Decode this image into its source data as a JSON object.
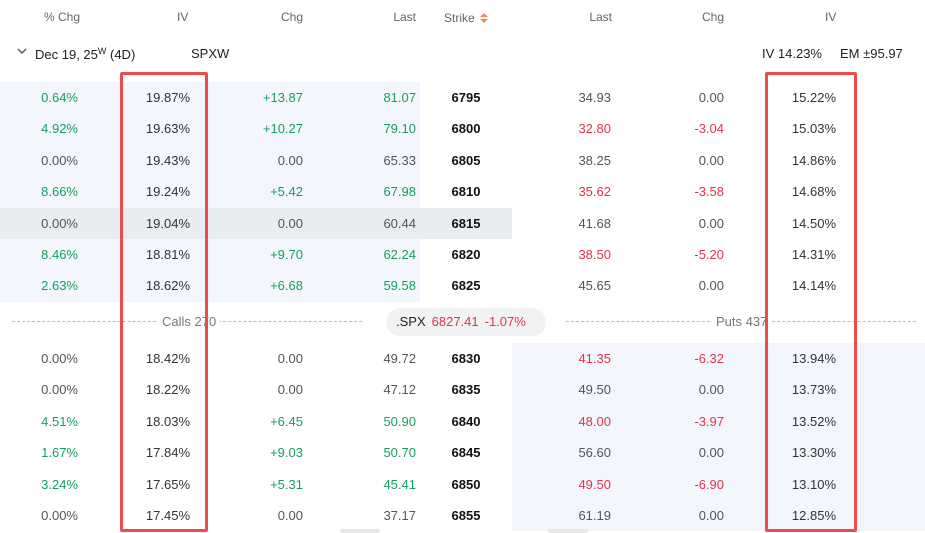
{
  "header": {
    "calls_pct_chg": "% Chg",
    "calls_iv": "IV",
    "calls_chg": "Chg",
    "calls_last": "Last",
    "strike": "Strike",
    "puts_last": "Last",
    "puts_chg": "Chg",
    "puts_iv": "IV"
  },
  "expiry": {
    "date": "Dec 19, 25",
    "superscript": "W",
    "days": "(4D)",
    "symbol": "SPXW",
    "iv": "IV 14.23%",
    "em": "EM ±95.97"
  },
  "rows_above": [
    {
      "c_pct": "0.64%",
      "c_pct_tone": "pos",
      "c_iv": "19.87%",
      "c_chg": "+13.87",
      "c_chg_tone": "pos",
      "c_last": "81.07",
      "c_last_tone": "pos",
      "strike": "6795",
      "p_last": "34.93",
      "p_last_tone": "neu",
      "p_chg": "0.00",
      "p_chg_tone": "neu",
      "p_iv": "15.22%",
      "tone": "itm"
    },
    {
      "c_pct": "4.92%",
      "c_pct_tone": "pos",
      "c_iv": "19.63%",
      "c_chg": "+10.27",
      "c_chg_tone": "pos",
      "c_last": "79.10",
      "c_last_tone": "pos",
      "strike": "6800",
      "p_last": "32.80",
      "p_last_tone": "neg",
      "p_chg": "-3.04",
      "p_chg_tone": "neg",
      "p_iv": "15.03%",
      "tone": "itm"
    },
    {
      "c_pct": "0.00%",
      "c_pct_tone": "neu",
      "c_iv": "19.43%",
      "c_chg": "0.00",
      "c_chg_tone": "neu",
      "c_last": "65.33",
      "c_last_tone": "neu",
      "strike": "6805",
      "p_last": "38.25",
      "p_last_tone": "neu",
      "p_chg": "0.00",
      "p_chg_tone": "neu",
      "p_iv": "14.86%",
      "tone": "itm"
    },
    {
      "c_pct": "8.66%",
      "c_pct_tone": "pos",
      "c_iv": "19.24%",
      "c_chg": "+5.42",
      "c_chg_tone": "pos",
      "c_last": "67.98",
      "c_last_tone": "pos",
      "strike": "6810",
      "p_last": "35.62",
      "p_last_tone": "neg",
      "p_chg": "-3.58",
      "p_chg_tone": "neg",
      "p_iv": "14.68%",
      "tone": "itm"
    },
    {
      "c_pct": "0.00%",
      "c_pct_tone": "neu",
      "c_iv": "19.04%",
      "c_chg": "0.00",
      "c_chg_tone": "neu",
      "c_last": "60.44",
      "c_last_tone": "neu",
      "strike": "6815",
      "p_last": "41.68",
      "p_last_tone": "neu",
      "p_chg": "0.00",
      "p_chg_tone": "neu",
      "p_iv": "14.50%",
      "tone": "sel"
    },
    {
      "c_pct": "8.46%",
      "c_pct_tone": "pos",
      "c_iv": "18.81%",
      "c_chg": "+9.70",
      "c_chg_tone": "pos",
      "c_last": "62.24",
      "c_last_tone": "pos",
      "strike": "6820",
      "p_last": "38.50",
      "p_last_tone": "neg",
      "p_chg": "-5.20",
      "p_chg_tone": "neg",
      "p_iv": "14.31%",
      "tone": "itm"
    },
    {
      "c_pct": "2.63%",
      "c_pct_tone": "pos",
      "c_iv": "18.62%",
      "c_chg": "+6.68",
      "c_chg_tone": "pos",
      "c_last": "59.58",
      "c_last_tone": "pos",
      "strike": "6825",
      "p_last": "45.65",
      "p_last_tone": "neu",
      "p_chg": "0.00",
      "p_chg_tone": "neu",
      "p_iv": "14.14%",
      "tone": "itm"
    }
  ],
  "divider": {
    "calls_label": "Calls 270",
    "symbol": ".SPX",
    "price": "6827.41",
    "pct": "-1.07%",
    "puts_label": "Puts 437"
  },
  "rows_below": [
    {
      "c_pct": "0.00%",
      "c_pct_tone": "neu",
      "c_iv": "18.42%",
      "c_chg": "0.00",
      "c_chg_tone": "neu",
      "c_last": "49.72",
      "c_last_tone": "neu",
      "strike": "6830",
      "p_last": "41.35",
      "p_last_tone": "neg",
      "p_chg": "-6.32",
      "p_chg_tone": "neg",
      "p_iv": "13.94%",
      "tone": "otm"
    },
    {
      "c_pct": "0.00%",
      "c_pct_tone": "neu",
      "c_iv": "18.22%",
      "c_chg": "0.00",
      "c_chg_tone": "neu",
      "c_last": "47.12",
      "c_last_tone": "neu",
      "strike": "6835",
      "p_last": "49.50",
      "p_last_tone": "neu",
      "p_chg": "0.00",
      "p_chg_tone": "neu",
      "p_iv": "13.73%",
      "tone": "otm"
    },
    {
      "c_pct": "4.51%",
      "c_pct_tone": "pos",
      "c_iv": "18.03%",
      "c_chg": "+6.45",
      "c_chg_tone": "pos",
      "c_last": "50.90",
      "c_last_tone": "pos",
      "strike": "6840",
      "p_last": "48.00",
      "p_last_tone": "neg",
      "p_chg": "-3.97",
      "p_chg_tone": "neg",
      "p_iv": "13.52%",
      "tone": "otm"
    },
    {
      "c_pct": "1.67%",
      "c_pct_tone": "pos",
      "c_iv": "17.84%",
      "c_chg": "+9.03",
      "c_chg_tone": "pos",
      "c_last": "50.70",
      "c_last_tone": "pos",
      "strike": "6845",
      "p_last": "56.60",
      "p_last_tone": "neu",
      "p_chg": "0.00",
      "p_chg_tone": "neu",
      "p_iv": "13.30%",
      "tone": "otm"
    },
    {
      "c_pct": "3.24%",
      "c_pct_tone": "pos",
      "c_iv": "17.65%",
      "c_chg": "+5.31",
      "c_chg_tone": "pos",
      "c_last": "45.41",
      "c_last_tone": "pos",
      "strike": "6850",
      "p_last": "49.50",
      "p_last_tone": "neg",
      "p_chg": "-6.90",
      "p_chg_tone": "neg",
      "p_iv": "13.10%",
      "tone": "otm"
    },
    {
      "c_pct": "0.00%",
      "c_pct_tone": "neu",
      "c_iv": "17.45%",
      "c_chg": "0.00",
      "c_chg_tone": "neu",
      "c_last": "37.17",
      "c_last_tone": "neu",
      "strike": "6855",
      "p_last": "61.19",
      "p_last_tone": "neu",
      "p_chg": "0.00",
      "p_chg_tone": "neu",
      "p_iv": "12.85%",
      "tone": "otm"
    }
  ],
  "colors": {
    "positive": "#14a15f",
    "negative": "#e5334a",
    "highlight_box": "#ef4b4b",
    "row_tint": "#f3f6fd",
    "selected_row": "#e9ecf1"
  },
  "icons": {
    "expand": "chevron-down-icon",
    "sort": "sort-arrows-icon"
  }
}
